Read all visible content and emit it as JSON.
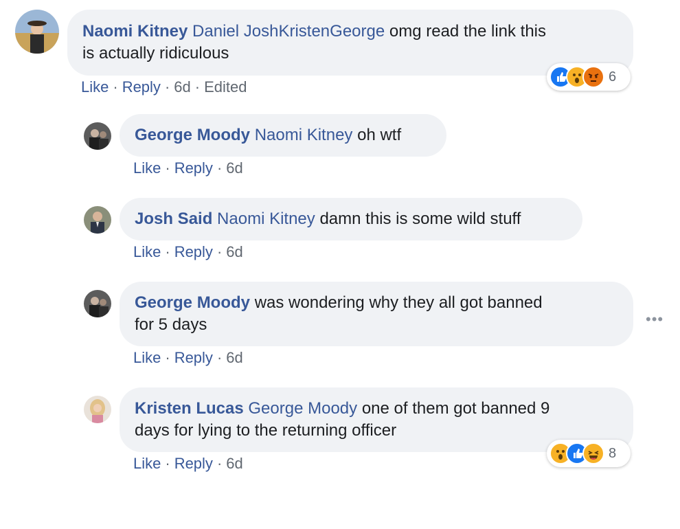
{
  "comments": [
    {
      "author": "Naomi Kitney",
      "tags": [
        "Daniel Josh",
        "Kristen",
        "George"
      ],
      "text_line1": "omg read the link this",
      "text_line2": "is actually ridiculous",
      "actions": {
        "like": "Like",
        "reply": "Reply",
        "time": "6d",
        "edited": "Edited"
      },
      "reactions": {
        "icons": [
          "like-icon",
          "wow-icon",
          "angry-icon"
        ],
        "count": "6"
      }
    },
    {
      "author": "George Moody",
      "tag": "Naomi Kitney",
      "text": "oh wtf",
      "actions": {
        "like": "Like",
        "reply": "Reply",
        "time": "6d"
      }
    },
    {
      "author": "Josh Said",
      "tag": "Naomi Kitney",
      "text": "damn this is some wild stuff",
      "actions": {
        "like": "Like",
        "reply": "Reply",
        "time": "6d"
      }
    },
    {
      "author": "George Moody",
      "text_line1": "was wondering why they all got banned",
      "text_line2": "for 5 days",
      "actions": {
        "like": "Like",
        "reply": "Reply",
        "time": "6d"
      }
    },
    {
      "author": "Kristen Lucas",
      "tag": "George Moody",
      "text_line1": "one of them got banned 9",
      "text_line2": "days for lying to the returning officer",
      "actions": {
        "like": "Like",
        "reply": "Reply",
        "time": "6d"
      },
      "reactions": {
        "icons": [
          "wow-icon",
          "like-icon",
          "haha-icon"
        ],
        "count": "8"
      }
    }
  ],
  "colors": {
    "link": "#385898",
    "bubble": "#f0f2f5",
    "meta": "#606770"
  }
}
